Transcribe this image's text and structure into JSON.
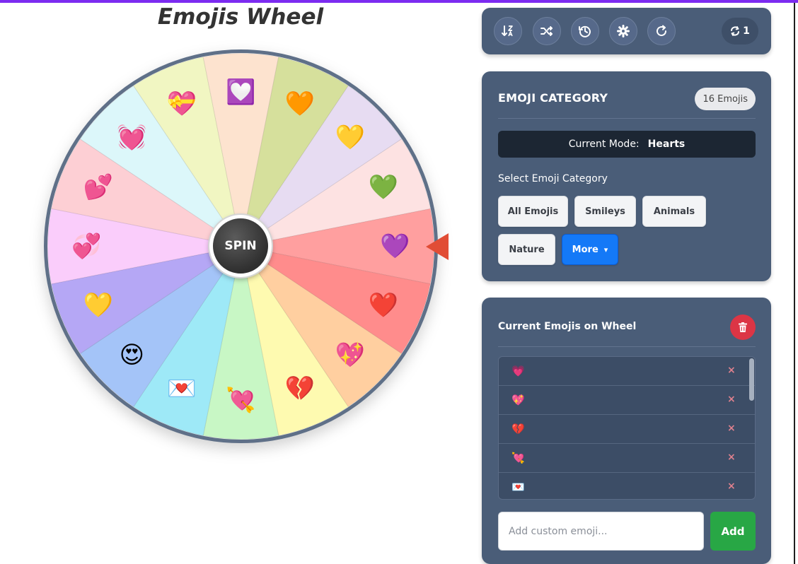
{
  "title": "Emojis Wheel",
  "wheel": {
    "spin_label": "SPIN",
    "rim_color": "#5f7088",
    "segments": [
      {
        "emoji": "💜",
        "color": "#ff9f9f"
      },
      {
        "emoji": "❤️",
        "color": "#ff8c8c"
      },
      {
        "emoji": "💖",
        "color": "#ffcfa0"
      },
      {
        "emoji": "💔",
        "color": "#fefab0"
      },
      {
        "emoji": "💘",
        "color": "#c8f7c5"
      },
      {
        "emoji": "💌",
        "color": "#9ee9f7"
      },
      {
        "emoji": "😍",
        "color": "#a4c4f8"
      },
      {
        "emoji": "💛",
        "color": "#b5a7f5"
      },
      {
        "emoji": "💞",
        "color": "#facdfb"
      },
      {
        "emoji": "💕",
        "color": "#fdcfd4"
      },
      {
        "emoji": "💓",
        "color": "#dcf7fa"
      },
      {
        "emoji": "💝",
        "color": "#f1f6c2"
      },
      {
        "emoji": "💟",
        "color": "#fde3cf"
      },
      {
        "emoji": "🧡",
        "color": "#d6e09c"
      },
      {
        "emoji": "💛",
        "color": "#e7dcf2"
      },
      {
        "emoji": "💚",
        "color": "#fde2e2"
      }
    ]
  },
  "toolbar": {
    "icons": [
      "sort-icon",
      "shuffle-icon",
      "history-icon",
      "gear-icon",
      "reload-icon"
    ],
    "spin_count": "1"
  },
  "category": {
    "heading": "EMOJI CATEGORY",
    "count_badge": "16 Emojis",
    "mode_label": "Current Mode:",
    "mode_value": "Hearts",
    "select_label": "Select Emoji Category",
    "buttons": [
      "All Emojis",
      "Smileys",
      "Animals",
      "Nature"
    ],
    "more_label": "More",
    "more_caret": "▾"
  },
  "current": {
    "heading": "Current Emojis on Wheel",
    "remove_symbol": "×",
    "items": [
      "💗",
      "💖",
      "💔",
      "💘",
      "💌"
    ]
  },
  "custom": {
    "placeholder": "Add custom emoji...",
    "add_label": "Add"
  },
  "colors": {
    "accent_top": "#7c2bf0",
    "panel": "#4a5d78",
    "pointer": "#e14d35",
    "add": "#28a745",
    "danger": "#dc3545",
    "primary": "#1479f7"
  }
}
